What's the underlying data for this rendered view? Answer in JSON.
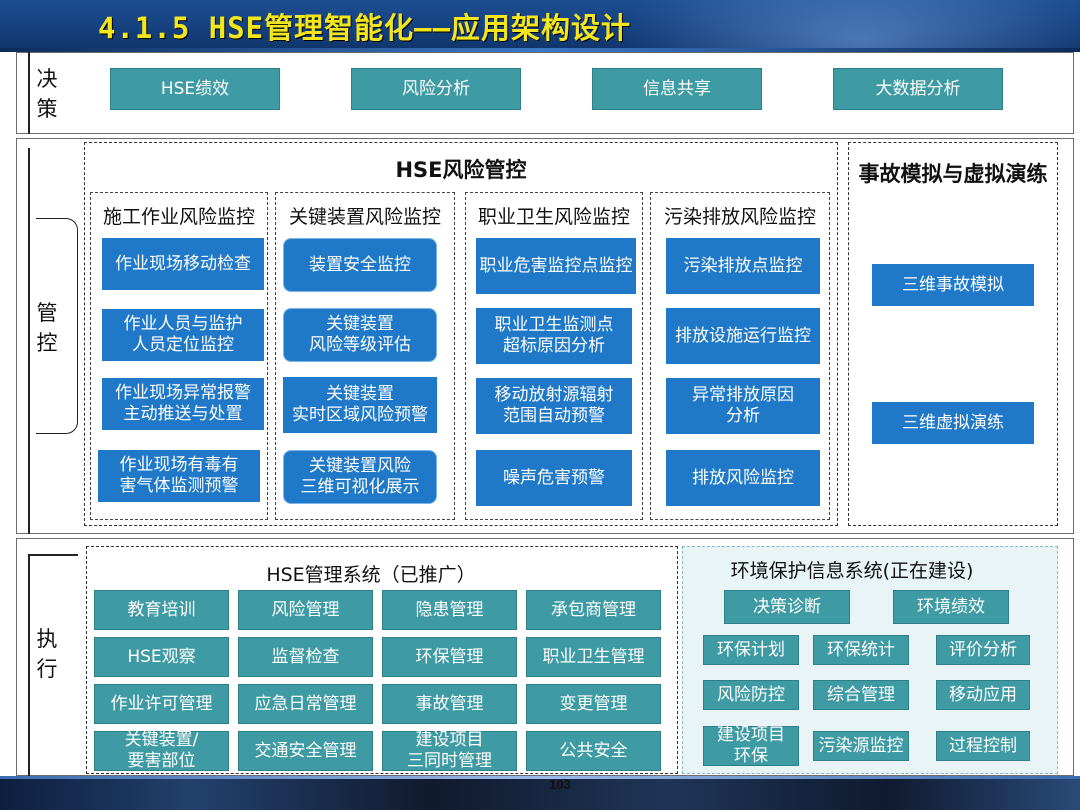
{
  "title": "4.1.5 HSE管理智能化——应用架构设计",
  "page_number": "103",
  "rows": {
    "decision": {
      "label": [
        "决",
        "策"
      ]
    },
    "control": {
      "label": [
        "管",
        "控"
      ]
    },
    "execution": {
      "label": [
        "执",
        "行"
      ]
    }
  },
  "decision_items": [
    "HSE绩效",
    "风险分析",
    "信息共享",
    "大数据分析"
  ],
  "risk_control": {
    "title": "HSE风险管控",
    "groups": [
      {
        "title": "施工作业风险监控",
        "items": [
          "作业现场移动检查",
          "作业人员与监护\n人员定位监控",
          "作业现场异常报警\n主动推送与处置",
          "作业现场有毒有\n害气体监测预警"
        ]
      },
      {
        "title": "关键装置风险监控",
        "items": [
          "装置安全监控",
          "关键装置\n风险等级评估",
          "关键装置\n实时区域风险预警",
          "关键装置风险\n三维可视化展示"
        ]
      },
      {
        "title": "职业卫生风险监控",
        "items": [
          "职业危害监控点监控",
          "职业卫生监测点\n超标原因分析",
          "移动放射源辐射\n范围自动预警",
          "噪声危害预警"
        ]
      },
      {
        "title": "污染排放风险监控",
        "items": [
          "污染排放点监控",
          "排放设施运行监控",
          "异常排放原因\n分析",
          "排放风险监控"
        ]
      }
    ]
  },
  "simulation": {
    "title": "事故模拟与虚拟演练",
    "items": [
      "三维事故模拟",
      "三维虚拟演练"
    ]
  },
  "hse_system": {
    "title": "HSE管理系统（已推广）",
    "items": [
      "教育培训",
      "风险管理",
      "隐患管理",
      "承包商管理",
      "HSE观察",
      "监督检查",
      "环保管理",
      "职业卫生管理",
      "作业许可管理",
      "应急日常管理",
      "事故管理",
      "变更管理",
      "关键装置/\n要害部位",
      "交通安全管理",
      "建设项目\n三同时管理",
      "公共安全"
    ]
  },
  "env_system": {
    "title": "环境保护信息系统(正在建设)",
    "items": [
      "决策诊断",
      "环境绩效",
      "环保计划",
      "环保统计",
      "评价分析",
      "风险防控",
      "综合管理",
      "移动应用",
      "建设项目\n环保",
      "污染源监控",
      "过程控制"
    ]
  },
  "colors": {
    "title_text": "#f4e61c",
    "title_band": "#1d4e93",
    "teal_box": "#3e9aa3",
    "blue_box": "#1f78c8",
    "env_panel_bg": "#e9f4f7"
  }
}
